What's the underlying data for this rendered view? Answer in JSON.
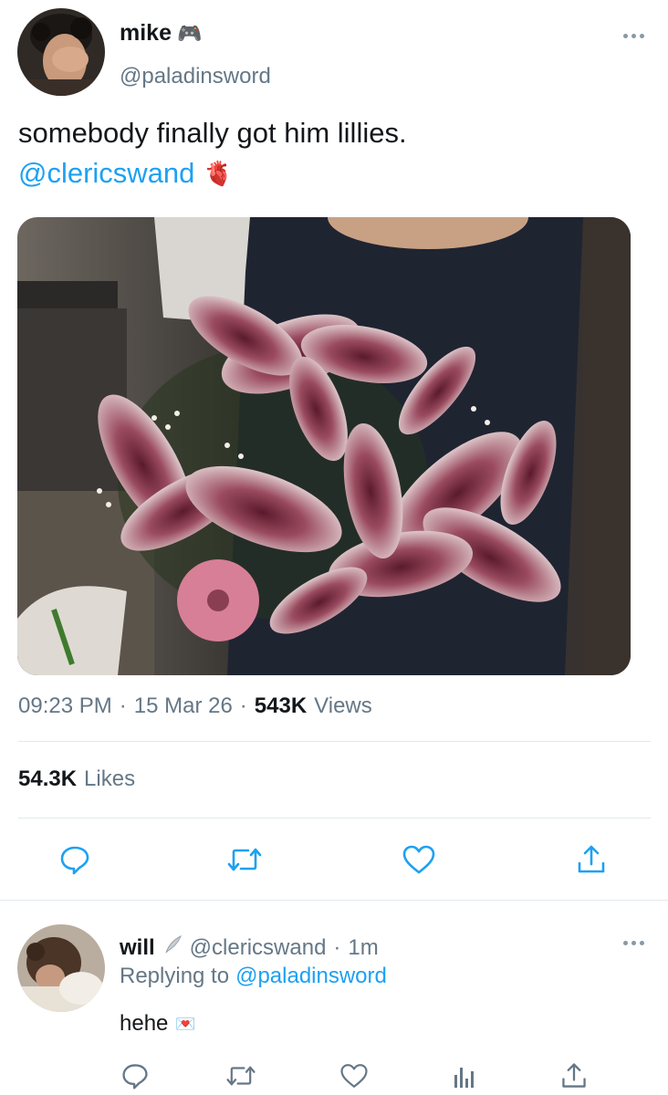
{
  "tweet": {
    "author": {
      "name": "mike",
      "name_emoji": "🎮",
      "handle": "@paladinsword"
    },
    "text": "somebody finally got him lillies.",
    "mention": "@clericswand",
    "mention_emoji": "🫀",
    "time": "09:23 PM",
    "date": "15 Mar 26",
    "views_count": "543K",
    "views_label": "Views",
    "likes_count": "54.3K",
    "likes_label": "Likes",
    "image_icon": "lily-bouquet-photo"
  },
  "reply": {
    "author": {
      "name": "will",
      "handle": "@clericswand",
      "time": "1m"
    },
    "replying_label": "Replying to",
    "replying_handle": "@paladinsword",
    "text": "hehe",
    "text_emoji": "💌"
  },
  "separator": "·",
  "colors": {
    "link": "#1da1f2",
    "muted": "#657786",
    "divider": "#e1e8ed",
    "icon": "#8899a6",
    "action_icon": "#1da1f2"
  }
}
